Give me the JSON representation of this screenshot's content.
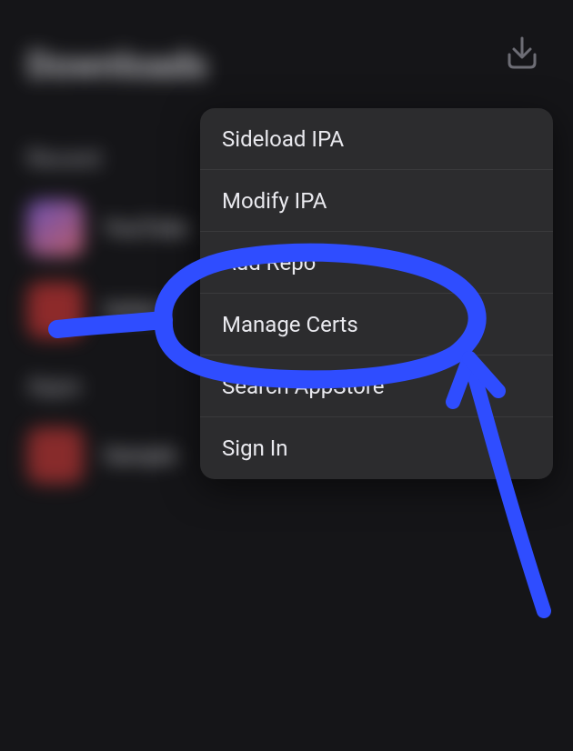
{
  "background": {
    "title": "Downloads",
    "section1": "Recent",
    "row1": "YouTube",
    "row2": "Safari",
    "section2": "Apps",
    "row3": "Sample"
  },
  "download_button": {
    "name": "download-icon"
  },
  "menu": {
    "items": [
      {
        "label": "Sideload IPA"
      },
      {
        "label": "Modify IPA"
      },
      {
        "label": "Add Repo"
      },
      {
        "label": "Manage Certs"
      },
      {
        "label": "Search AppStore"
      },
      {
        "label": "Sign In"
      }
    ]
  },
  "annotation": {
    "color": "#2f4dff",
    "circled_item_index": 3,
    "has_arrow": true
  }
}
